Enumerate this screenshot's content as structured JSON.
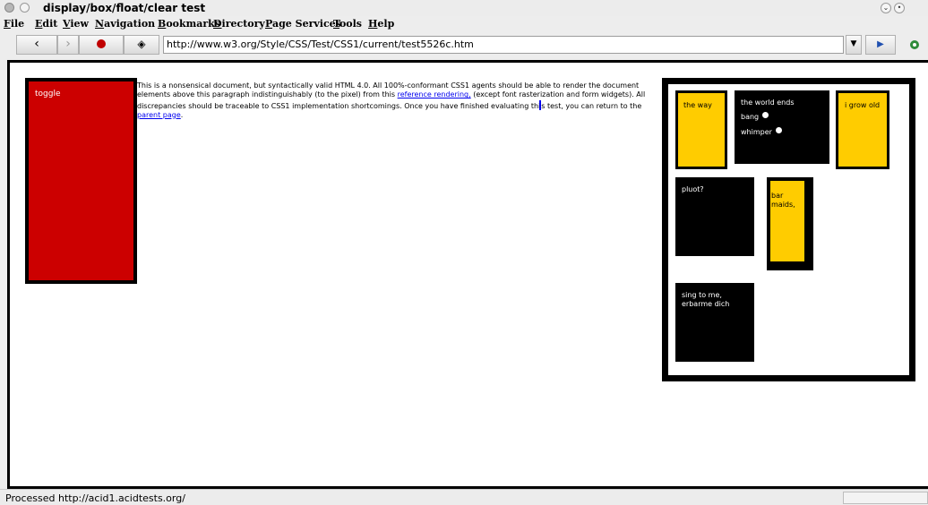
{
  "window": {
    "title": "display/box/float/clear test"
  },
  "menu": [
    "File",
    "Edit",
    "View",
    "Navigation",
    "Bookmarks",
    "Directory",
    "Page Services",
    "Tools",
    "Help"
  ],
  "toolbar": {
    "back_icon": "back-arrow-icon",
    "forward_icon": "forward-arrow-icon",
    "stop_icon": "stop-icon",
    "home_icon": "home-icon",
    "url": "http://www.w3.org/Style/CSS/Test/CSS1/current/test5526c.htm"
  },
  "page": {
    "toggle_label": "toggle",
    "paragraph": {
      "text1": "This is a nonsensical document, but syntactically valid HTML 4.0. All 100%-conformant CSS1 agents should be able to render the document elements above this paragraph indistinguishably (to the pixel) from this ",
      "link1": "reference rendering,",
      "text2": " (except font rasterization and form widgets). All discrepancies should be traceable to CSS1 implementation shortcomings. Once you have finished evaluating thi",
      "text3": "s test, you can return to the ",
      "link2": "parent page",
      "text4": "."
    },
    "blocks": {
      "the_way": "the way",
      "world_ends": "the world ends",
      "bang": "bang",
      "whimper": "whimper",
      "i_grow_old": "i grow old",
      "pluot": "pluot?",
      "bar_maids": "bar maids,",
      "sing_to_me": "sing to me, erbarme dich"
    },
    "colors": {
      "red": "#cc0000",
      "yellow": "#ffcc00",
      "black": "#000000"
    }
  },
  "status": {
    "text": "Processed http://acid1.acidtests.org/"
  }
}
